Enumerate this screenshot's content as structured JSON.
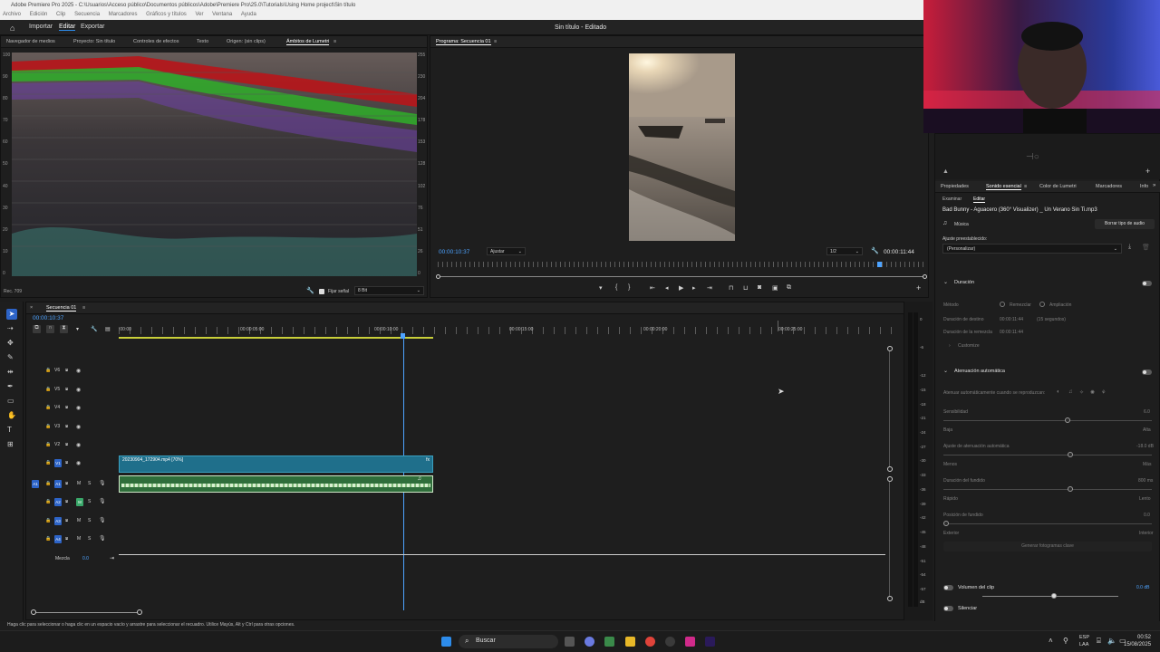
{
  "app": {
    "title": "Adobe Premiere Pro 2025 - C:\\Usuarios\\Acceso público\\Documentos públicos\\Adobe\\Premiere Pro\\25.0\\Tutorials\\Using Home project\\Sin título",
    "menu": [
      "Archivo",
      "Edición",
      "Clip",
      "Secuencia",
      "Marcadores",
      "Gráficos y títulos",
      "Ver",
      "Ventana",
      "Ayuda"
    ],
    "workspaces": [
      "Importar",
      "Editar",
      "Exportar"
    ],
    "doc_status": "Sin título - Editado"
  },
  "left_panel": {
    "tabs": [
      "Navegador de medios",
      "Proyecto: Sin título",
      "Controles de efectos",
      "Texto",
      "Origen: (sin clips)",
      "Ámbitos de Lumetri"
    ],
    "active_tab": "Ámbitos de Lumetri",
    "scale_left": [
      "100",
      "90",
      "80",
      "70",
      "60",
      "50",
      "40",
      "30",
      "20",
      "10",
      "0"
    ],
    "scale_right": [
      "255",
      "230",
      "204",
      "178",
      "153",
      "128",
      "102",
      "76",
      "51",
      "26",
      "0"
    ],
    "colorspace": "Rec. 709",
    "fix_signal_label": "Fijar señal",
    "bit_depth": "8 Bit"
  },
  "program_monitor": {
    "tab": "Programa: Secuencia 01",
    "timecode": "00:00:10:37",
    "fit": "Ajustar",
    "resolution": "1/2",
    "duration": "00:00:11:44"
  },
  "webcam_overlay": {
    "tab": "Propiedades"
  },
  "essential_sound": {
    "tabs": [
      "Propiedades",
      "Sonido esencial",
      "Color de Lumetri",
      "Marcadores",
      "Info"
    ],
    "active_tab": "Sonido esencial",
    "subtabs": [
      "Examinar",
      "Editar"
    ],
    "clip_name": "Bad Bunny - Aguacero (360° Visualizer) _ Un Verano Sin Ti.mp3",
    "type": "Música",
    "clear_type": "Borrar tipo de audio",
    "preset_label": "Ajuste preestablecido:",
    "preset_value": "(Personalizar)",
    "duration_section": "Duración",
    "method_label": "Método",
    "method_options": [
      "Remezclar",
      "Ampliación"
    ],
    "target_duration_label": "Duración de destino",
    "target_duration_value": "00:00:11:44",
    "target_duration_extra": "(15 segundos)",
    "remix_duration_label": "Duración de la remezcla",
    "remix_duration_value": "00:00:11:44",
    "customize": "Customize",
    "ducking_section": "Atenuación automática",
    "duck_against": "Atenuar automáticamente cuando se reproduzcan:",
    "sensitivity_label": "Sensibilidad",
    "sensitivity_value": "6.0",
    "low": "Baja",
    "high": "Alta",
    "ducking_amount_label": "Ajuste de atenuación automática",
    "ducking_amount_value": "-18.0 dB",
    "less": "Menos",
    "more": "Más",
    "fade_duration_label": "Duración del fundido",
    "fade_duration_value": "800 ms",
    "fast": "Rápido",
    "slow": "Lento",
    "fade_position_label": "Posición de fundido",
    "fade_position_value": "0.0",
    "outside": "Exterior",
    "inside": "Interior",
    "generate_keyframes": "Generar fotogramas clave",
    "clip_volume_label": "Volumen del clip",
    "clip_volume_value": "0.0 dB",
    "mute_label": "Silenciar"
  },
  "timeline": {
    "tab": "Secuencia 01",
    "timecode": "00:00:10:37",
    "ruler": [
      ":00:00",
      "00:00:05:00",
      "00:00:10:00",
      "00:00:15:00",
      "00:00:20:00",
      "00:00:25:00"
    ],
    "video_tracks": [
      "V6",
      "V5",
      "V4",
      "V3",
      "V2",
      "V1"
    ],
    "audio_tracks": [
      "A1",
      "A2",
      "A3",
      "A4"
    ],
    "source_patch": "A1",
    "mix_label": "Mezcla",
    "mix_value": "0.0",
    "video_clip": "20230904_172904.mp4 [70%]",
    "meter_scale": [
      "0",
      "-6",
      "-12",
      "-15",
      "-18",
      "-21",
      "-24",
      "-27",
      "-30",
      "-33",
      "-36",
      "-39",
      "-42",
      "-45",
      "-48",
      "-51",
      "-54",
      "-57",
      "dB"
    ]
  },
  "statusbar": {
    "hint": "Haga clic para seleccionar o haga clic en un espacio vacío y arrastre para seleccionar el recuadro. Utilice Mayús, Alt y Ctrl para otras opciones."
  },
  "taskbar": {
    "search": "Buscar",
    "lang": "ESP",
    "lang2": "LAA",
    "time": "00:52",
    "date": "15/08/2025"
  }
}
